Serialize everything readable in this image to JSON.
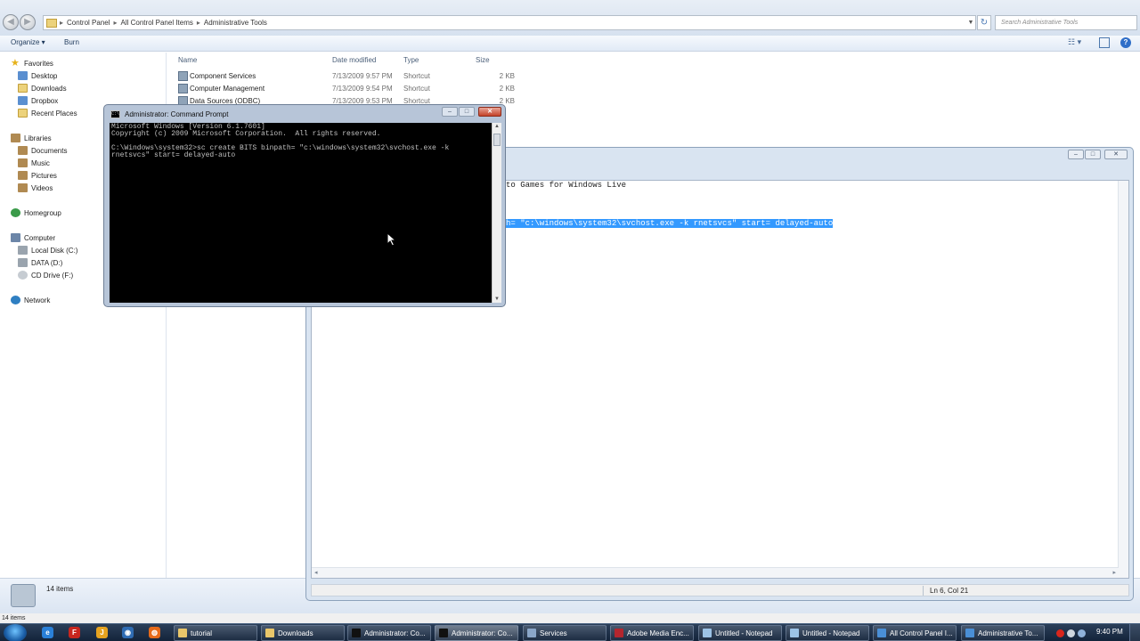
{
  "explorer": {
    "breadcrumb": [
      "Control Panel",
      "All Control Panel Items",
      "Administrative Tools"
    ],
    "search_placeholder": "Search Administrative Tools",
    "toolbar": {
      "organize_label": "Organize ▾",
      "burn_label": "Burn",
      "views_glyph": "☷ ▾",
      "help_glyph": "?"
    },
    "nav": {
      "favorites": "Favorites",
      "desktop": "Desktop",
      "downloads": "Downloads",
      "dropbox": "Dropbox",
      "recent_places": "Recent Places",
      "libraries": "Libraries",
      "documents": "Documents",
      "music": "Music",
      "pictures": "Pictures",
      "videos": "Videos",
      "homegroup": "Homegroup",
      "computer": "Computer",
      "local_disk": "Local Disk (C:)",
      "data_drive": "DATA (D:)",
      "cd_drive": "CD Drive (F:)",
      "network": "Network"
    },
    "columns": {
      "name": "Name",
      "date": "Date modified",
      "type": "Type",
      "size": "Size"
    },
    "files": [
      {
        "name": "Component Services",
        "date": "7/13/2009 9:57 PM",
        "type": "Shortcut",
        "size": "2 KB"
      },
      {
        "name": "Computer Management",
        "date": "7/13/2009 9:54 PM",
        "type": "Shortcut",
        "size": "2 KB"
      },
      {
        "name": "Data Sources (ODBC)",
        "date": "7/13/2009 9:53 PM",
        "type": "Shortcut",
        "size": "2 KB"
      }
    ],
    "details_count": "14 items",
    "status_text": "14 items"
  },
  "notepad": {
    "line1": "to Games for Windows Live",
    "line2_selected": "h= \"c:\\windows\\system32\\svchost.exe -k rnetsvcs\" start= delayed-auto",
    "status_position": "Ln 6, Col 21"
  },
  "cmd": {
    "title": "Administrator: Command Prompt",
    "icon_text": "C:\\",
    "console_text": "Microsoft Windows [Version 6.1.7601]\nCopyright (c) 2009 Microsoft Corporation.  All rights reserved.\n\nC:\\Windows\\system32>sc create BITS binpath= \"c:\\windows\\system32\\svchost.exe -k\nrnetsvcs\" start= delayed-auto"
  },
  "taskbar": {
    "buttons": [
      {
        "label": "tutorial",
        "icon_color": "#e9c66a",
        "active": false
      },
      {
        "label": "Downloads",
        "icon_color": "#e9c66a",
        "active": false
      },
      {
        "label": "Administrator: Co...",
        "icon_color": "#111111",
        "active": false
      },
      {
        "label": "Administrator: Co...",
        "icon_color": "#111111",
        "active": true
      },
      {
        "label": "Services",
        "icon_color": "#8aa6c8",
        "active": false
      },
      {
        "label": "Adobe Media Enc...",
        "icon_color": "#b3262e",
        "active": false
      },
      {
        "label": "Untitled - Notepad",
        "icon_color": "#9cc3e6",
        "active": false
      },
      {
        "label": "Untitled - Notepad",
        "icon_color": "#9cc3e6",
        "active": false
      },
      {
        "label": "All Control Panel I...",
        "icon_color": "#4a8fd6",
        "active": false
      },
      {
        "label": "Administrative To...",
        "icon_color": "#4a8fd6",
        "active": false
      }
    ],
    "quicklaunch": [
      {
        "name": "ie-icon",
        "glyph": "e",
        "color": "#2a80d8"
      },
      {
        "name": "filezilla-icon",
        "glyph": "F",
        "color": "#c8261e"
      },
      {
        "name": "jdownloader-icon",
        "glyph": "J",
        "color": "#e6a320"
      },
      {
        "name": "media-icon",
        "glyph": "◉",
        "color": "#2f6cb3"
      },
      {
        "name": "firefox-icon",
        "glyph": "◍",
        "color": "#e66a1a"
      }
    ],
    "clock": "9:40 PM"
  },
  "colors": {
    "selection": "#3399ff",
    "console_bg": "#000000",
    "console_fg": "#c0c0c0",
    "taskbar": "#1c2e47"
  }
}
